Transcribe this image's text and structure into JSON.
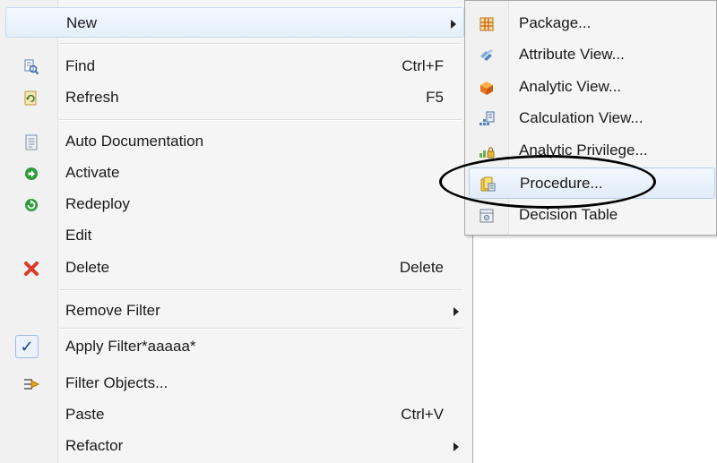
{
  "main_menu": {
    "items": [
      {
        "label": "New",
        "shortcut": "",
        "submenu": true
      },
      {
        "label": "Find",
        "shortcut": "Ctrl+F"
      },
      {
        "label": "Refresh",
        "shortcut": "F5"
      },
      {
        "label": "Auto Documentation",
        "shortcut": ""
      },
      {
        "label": "Activate",
        "shortcut": ""
      },
      {
        "label": "Redeploy",
        "shortcut": ""
      },
      {
        "label": "Edit",
        "shortcut": ""
      },
      {
        "label": "Delete",
        "shortcut": "Delete"
      },
      {
        "label": "Remove Filter",
        "shortcut": "",
        "submenu": true
      },
      {
        "label": "Apply Filter*aaaaa*",
        "shortcut": "",
        "checked": true
      },
      {
        "label": "Filter Objects...",
        "shortcut": ""
      },
      {
        "label": "Paste",
        "shortcut": "Ctrl+V"
      },
      {
        "label": "Refactor",
        "shortcut": "",
        "submenu": true
      }
    ]
  },
  "sub_menu": {
    "items": [
      {
        "label": "Package..."
      },
      {
        "label": "Attribute View..."
      },
      {
        "label": "Analytic View..."
      },
      {
        "label": "Calculation View..."
      },
      {
        "label": "Analytic Privilege..."
      },
      {
        "label": "Procedure..."
      },
      {
        "label": "Decision Table"
      }
    ]
  },
  "colors": {
    "highlight_border": "#c8daef",
    "annotation_ellipse": "#000000",
    "activate_green": "#2e9b3a",
    "delete_red": "#d93a2b"
  }
}
